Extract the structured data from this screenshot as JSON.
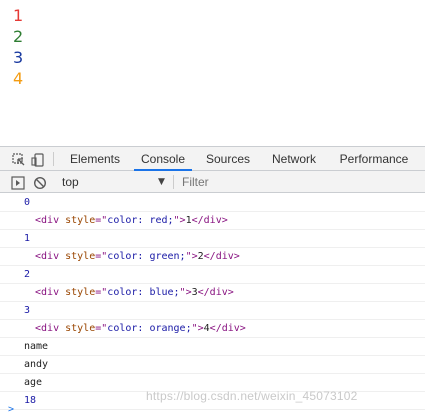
{
  "page": {
    "lines": [
      {
        "text": "1",
        "color": "#e53935"
      },
      {
        "text": "2",
        "color": "#2e7d32"
      },
      {
        "text": "3",
        "color": "#1a3aa0"
      },
      {
        "text": "4",
        "color": "#f39c12"
      }
    ]
  },
  "devtools": {
    "tabs": [
      "Elements",
      "Console",
      "Sources",
      "Network",
      "Performance"
    ],
    "active_tab": "Console",
    "icons": [
      "inspect-icon",
      "device-toolbar-icon",
      "sidebar-icon",
      "clear-console-icon"
    ],
    "context": "top",
    "filter_placeholder": "Filter",
    "accent": "#1a73e8"
  },
  "console": {
    "messages": [
      {
        "type": "number",
        "text": "0"
      },
      {
        "type": "element",
        "tag": "div",
        "attr": "style",
        "value": "color: red;",
        "text": "1"
      },
      {
        "type": "number",
        "text": "1"
      },
      {
        "type": "element",
        "tag": "div",
        "attr": "style",
        "value": "color: green;",
        "text": "2"
      },
      {
        "type": "number",
        "text": "2"
      },
      {
        "type": "element",
        "tag": "div",
        "attr": "style",
        "value": "color: blue;",
        "text": "3"
      },
      {
        "type": "number",
        "text": "3"
      },
      {
        "type": "element",
        "tag": "div",
        "attr": "style",
        "value": "color: orange;",
        "text": "4"
      },
      {
        "type": "string",
        "text": "name"
      },
      {
        "type": "string",
        "text": "andy"
      },
      {
        "type": "string",
        "text": "age"
      },
      {
        "type": "number",
        "text": "18"
      }
    ],
    "prompt_symbol": ">"
  },
  "watermark": "https://blog.csdn.net/weixin_45073102"
}
